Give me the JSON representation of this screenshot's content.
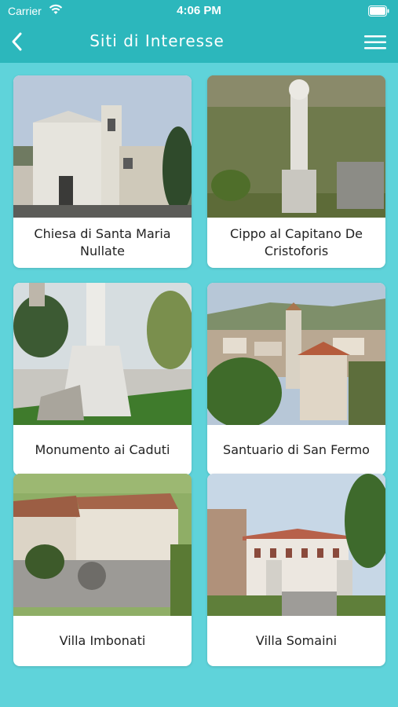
{
  "status_bar": {
    "carrier": "Carrier",
    "time": "4:06 PM"
  },
  "nav": {
    "title": "Siti di Interesse",
    "back_icon": "chevron-left-icon",
    "menu_icon": "hamburger-menu-icon"
  },
  "colors": {
    "header": "#2cb7bc",
    "background": "#5fd3da",
    "card": "#ffffff"
  },
  "sites": [
    {
      "label": "Chiesa di Santa Maria Nullate"
    },
    {
      "label": "Cippo al Capitano De Cristoforis"
    },
    {
      "label": "Monumento ai Caduti"
    },
    {
      "label": "Santuario di San Fermo"
    },
    {
      "label": "Villa Imbonati"
    },
    {
      "label": "Villa Somaini"
    }
  ]
}
